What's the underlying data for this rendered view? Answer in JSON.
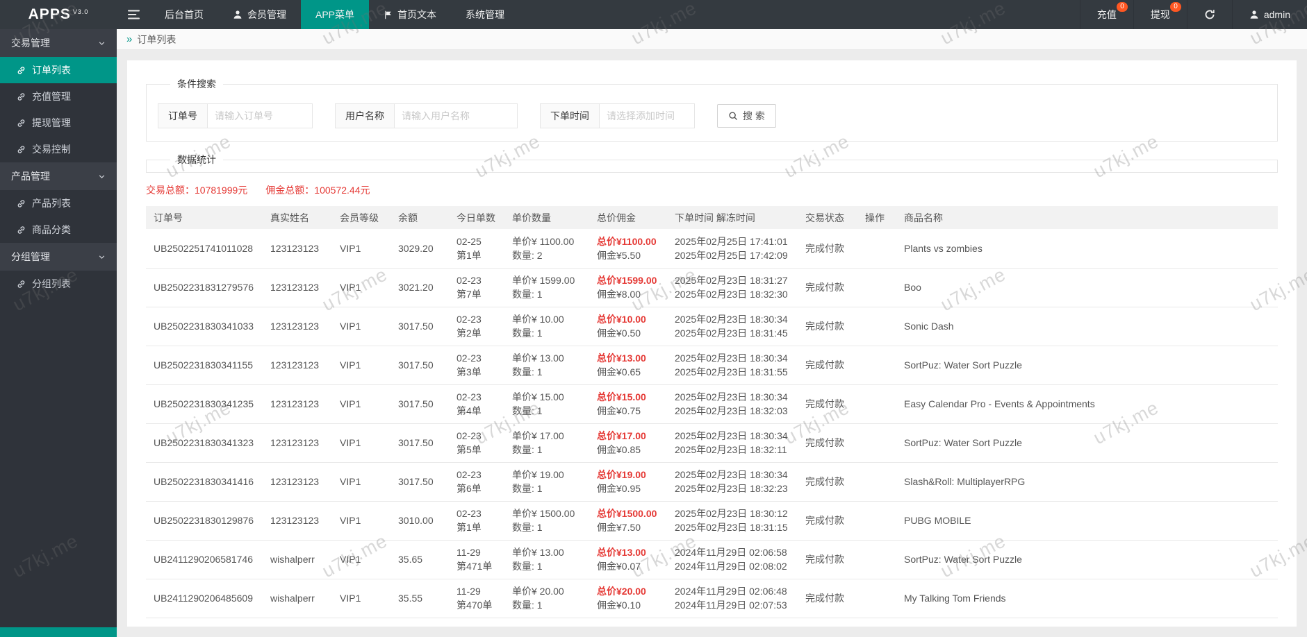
{
  "colors": {
    "accent": "#009688",
    "badge": "#ff5722",
    "red": "#e53935",
    "navbar": "#343a40",
    "sidebar": "#2f333a",
    "sidebargroup": "#3b3f47"
  },
  "watermark": {
    "text": "u7kj.me"
  },
  "navbar": {
    "logo": "APPS",
    "logo_version": "V3.0",
    "tabs": [
      {
        "label": "后台首页",
        "icon": null,
        "active": false
      },
      {
        "label": "会员管理",
        "icon": "person",
        "active": false
      },
      {
        "label": "APP菜单",
        "icon": null,
        "active": true
      },
      {
        "label": "首页文本",
        "icon": "flag",
        "active": false
      },
      {
        "label": "系统管理",
        "icon": null,
        "active": false
      }
    ],
    "recharge_label": "充值",
    "recharge_badge": "0",
    "withdraw_label": "提现",
    "withdraw_badge": "0",
    "username": "admin"
  },
  "sidebar": {
    "groups": [
      {
        "label": "交易管理",
        "items": [
          {
            "label": "订单列表",
            "active": true
          },
          {
            "label": "充值管理",
            "active": false
          },
          {
            "label": "提现管理",
            "active": false
          },
          {
            "label": "交易控制",
            "active": false
          }
        ]
      },
      {
        "label": "产品管理",
        "items": [
          {
            "label": "产品列表",
            "active": false
          },
          {
            "label": "商品分类",
            "active": false
          }
        ]
      },
      {
        "label": "分组管理",
        "items": [
          {
            "label": "分组列表",
            "active": false
          }
        ]
      }
    ]
  },
  "breadcrumb": {
    "separator": "»",
    "current": "订单列表"
  },
  "search": {
    "legend": "条件搜索",
    "fields": [
      {
        "label": "订单号",
        "placeholder": "请输入订单号"
      },
      {
        "label": "用户名称",
        "placeholder": "请输入用户名称"
      },
      {
        "label": "下单时间",
        "placeholder": "请选择添加时间"
      }
    ],
    "button": "搜 索"
  },
  "stats": {
    "legend": "数据统计",
    "total_label": "交易总额：",
    "total_value": "10781999元",
    "commission_label": "佣金总额：",
    "commission_value": "100572.44元"
  },
  "table": {
    "columns": [
      "订单号",
      "真实姓名",
      "会员等级",
      "余额",
      "今日单数",
      "单价数量",
      "总价佣金",
      "下单时间 解冻时间",
      "交易状态",
      "操作",
      "商品名称"
    ],
    "rows": [
      {
        "order_no": "UB2502251741011028",
        "real_name": "123123123",
        "level": "VIP1",
        "balance": "3029.20",
        "today_date": "02-25",
        "today_count": "第1单",
        "unit_price": "单价¥ 1100.00",
        "quantity": "数量: 2",
        "total": "总价¥1100.00",
        "commission": "佣金¥5.50",
        "order_time": "2025年02月25日 17:41:01",
        "unfreeze_time": "2025年02月25日 17:42:09",
        "status": "完成付款",
        "product": "Plants vs zombies"
      },
      {
        "order_no": "UB2502231831279576",
        "real_name": "123123123",
        "level": "VIP1",
        "balance": "3021.20",
        "today_date": "02-23",
        "today_count": "第7单",
        "unit_price": "单价¥ 1599.00",
        "quantity": "数量: 1",
        "total": "总价¥1599.00",
        "commission": "佣金¥8.00",
        "order_time": "2025年02月23日 18:31:27",
        "unfreeze_time": "2025年02月23日 18:32:30",
        "status": "完成付款",
        "product": "Boo"
      },
      {
        "order_no": "UB2502231830341033",
        "real_name": "123123123",
        "level": "VIP1",
        "balance": "3017.50",
        "today_date": "02-23",
        "today_count": "第2单",
        "unit_price": "单价¥ 10.00",
        "quantity": "数量: 1",
        "total": "总价¥10.00",
        "commission": "佣金¥0.50",
        "order_time": "2025年02月23日 18:30:34",
        "unfreeze_time": "2025年02月23日 18:31:45",
        "status": "完成付款",
        "product": "Sonic Dash"
      },
      {
        "order_no": "UB2502231830341155",
        "real_name": "123123123",
        "level": "VIP1",
        "balance": "3017.50",
        "today_date": "02-23",
        "today_count": "第3单",
        "unit_price": "单价¥ 13.00",
        "quantity": "数量: 1",
        "total": "总价¥13.00",
        "commission": "佣金¥0.65",
        "order_time": "2025年02月23日 18:30:34",
        "unfreeze_time": "2025年02月23日 18:31:55",
        "status": "完成付款",
        "product": "SortPuz: Water Sort Puzzle"
      },
      {
        "order_no": "UB2502231830341235",
        "real_name": "123123123",
        "level": "VIP1",
        "balance": "3017.50",
        "today_date": "02-23",
        "today_count": "第4单",
        "unit_price": "单价¥ 15.00",
        "quantity": "数量: 1",
        "total": "总价¥15.00",
        "commission": "佣金¥0.75",
        "order_time": "2025年02月23日 18:30:34",
        "unfreeze_time": "2025年02月23日 18:32:03",
        "status": "完成付款",
        "product": "Easy Calendar Pro - Events & Appointments"
      },
      {
        "order_no": "UB2502231830341323",
        "real_name": "123123123",
        "level": "VIP1",
        "balance": "3017.50",
        "today_date": "02-23",
        "today_count": "第5单",
        "unit_price": "单价¥ 17.00",
        "quantity": "数量: 1",
        "total": "总价¥17.00",
        "commission": "佣金¥0.85",
        "order_time": "2025年02月23日 18:30:34",
        "unfreeze_time": "2025年02月23日 18:32:11",
        "status": "完成付款",
        "product": "SortPuz: Water Sort Puzzle"
      },
      {
        "order_no": "UB2502231830341416",
        "real_name": "123123123",
        "level": "VIP1",
        "balance": "3017.50",
        "today_date": "02-23",
        "today_count": "第6单",
        "unit_price": "单价¥ 19.00",
        "quantity": "数量: 1",
        "total": "总价¥19.00",
        "commission": "佣金¥0.95",
        "order_time": "2025年02月23日 18:30:34",
        "unfreeze_time": "2025年02月23日 18:32:23",
        "status": "完成付款",
        "product": "Slash&Roll: MultiplayerRPG"
      },
      {
        "order_no": "UB2502231830129876",
        "real_name": "123123123",
        "level": "VIP1",
        "balance": "3010.00",
        "today_date": "02-23",
        "today_count": "第1单",
        "unit_price": "单价¥ 1500.00",
        "quantity": "数量: 1",
        "total": "总价¥1500.00",
        "commission": "佣金¥7.50",
        "order_time": "2025年02月23日 18:30:12",
        "unfreeze_time": "2025年02月23日 18:31:15",
        "status": "完成付款",
        "product": "PUBG MOBILE"
      },
      {
        "order_no": "UB2411290206581746",
        "real_name": "wishalperr",
        "level": "VIP1",
        "balance": "35.65",
        "today_date": "11-29",
        "today_count": "第471单",
        "unit_price": "单价¥ 13.00",
        "quantity": "数量: 1",
        "total": "总价¥13.00",
        "commission": "佣金¥0.07",
        "order_time": "2024年11月29日 02:06:58",
        "unfreeze_time": "2024年11月29日 02:08:02",
        "status": "完成付款",
        "product": "SortPuz: Water Sort Puzzle"
      },
      {
        "order_no": "UB2411290206485609",
        "real_name": "wishalperr",
        "level": "VIP1",
        "balance": "35.55",
        "today_date": "11-29",
        "today_count": "第470单",
        "unit_price": "单价¥ 20.00",
        "quantity": "数量: 1",
        "total": "总价¥20.00",
        "commission": "佣金¥0.10",
        "order_time": "2024年11月29日 02:06:48",
        "unfreeze_time": "2024年11月29日 02:07:53",
        "status": "完成付款",
        "product": "My Talking Tom Friends"
      }
    ]
  }
}
